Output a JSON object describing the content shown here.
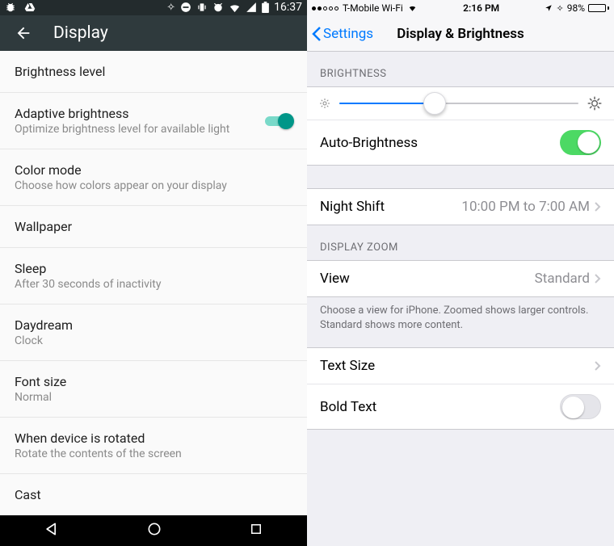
{
  "android": {
    "status_time": "16:37",
    "header_title": "Display",
    "rows": [
      {
        "title": "Brightness level",
        "sub": ""
      },
      {
        "title": "Adaptive brightness",
        "sub": "Optimize brightness level for available light",
        "toggle": true
      },
      {
        "title": "Color mode",
        "sub": "Choose how colors appear on your display"
      },
      {
        "title": "Wallpaper",
        "sub": ""
      },
      {
        "title": "Sleep",
        "sub": "After 30 seconds of inactivity"
      },
      {
        "title": "Daydream",
        "sub": "Clock"
      },
      {
        "title": "Font size",
        "sub": "Normal"
      },
      {
        "title": "When device is rotated",
        "sub": "Rotate the contents of the screen"
      },
      {
        "title": "Cast",
        "sub": ""
      }
    ]
  },
  "ios": {
    "carrier": "T-Mobile Wi-Fi",
    "time": "2:16 PM",
    "battery_pct": "98%",
    "back_label": "Settings",
    "title": "Display & Brightness",
    "section_brightness": "BRIGHTNESS",
    "brightness_slider_pct": 40,
    "autobrightness_label": "Auto-Brightness",
    "autobrightness_on": true,
    "nightshift_label": "Night Shift",
    "nightshift_value": "10:00 PM to 7:00 AM",
    "section_zoom": "DISPLAY ZOOM",
    "view_label": "View",
    "view_value": "Standard",
    "zoom_note": "Choose a view for iPhone. Zoomed shows larger controls. Standard shows more content.",
    "textsize_label": "Text Size",
    "boldtext_label": "Bold Text",
    "boldtext_on": false
  }
}
